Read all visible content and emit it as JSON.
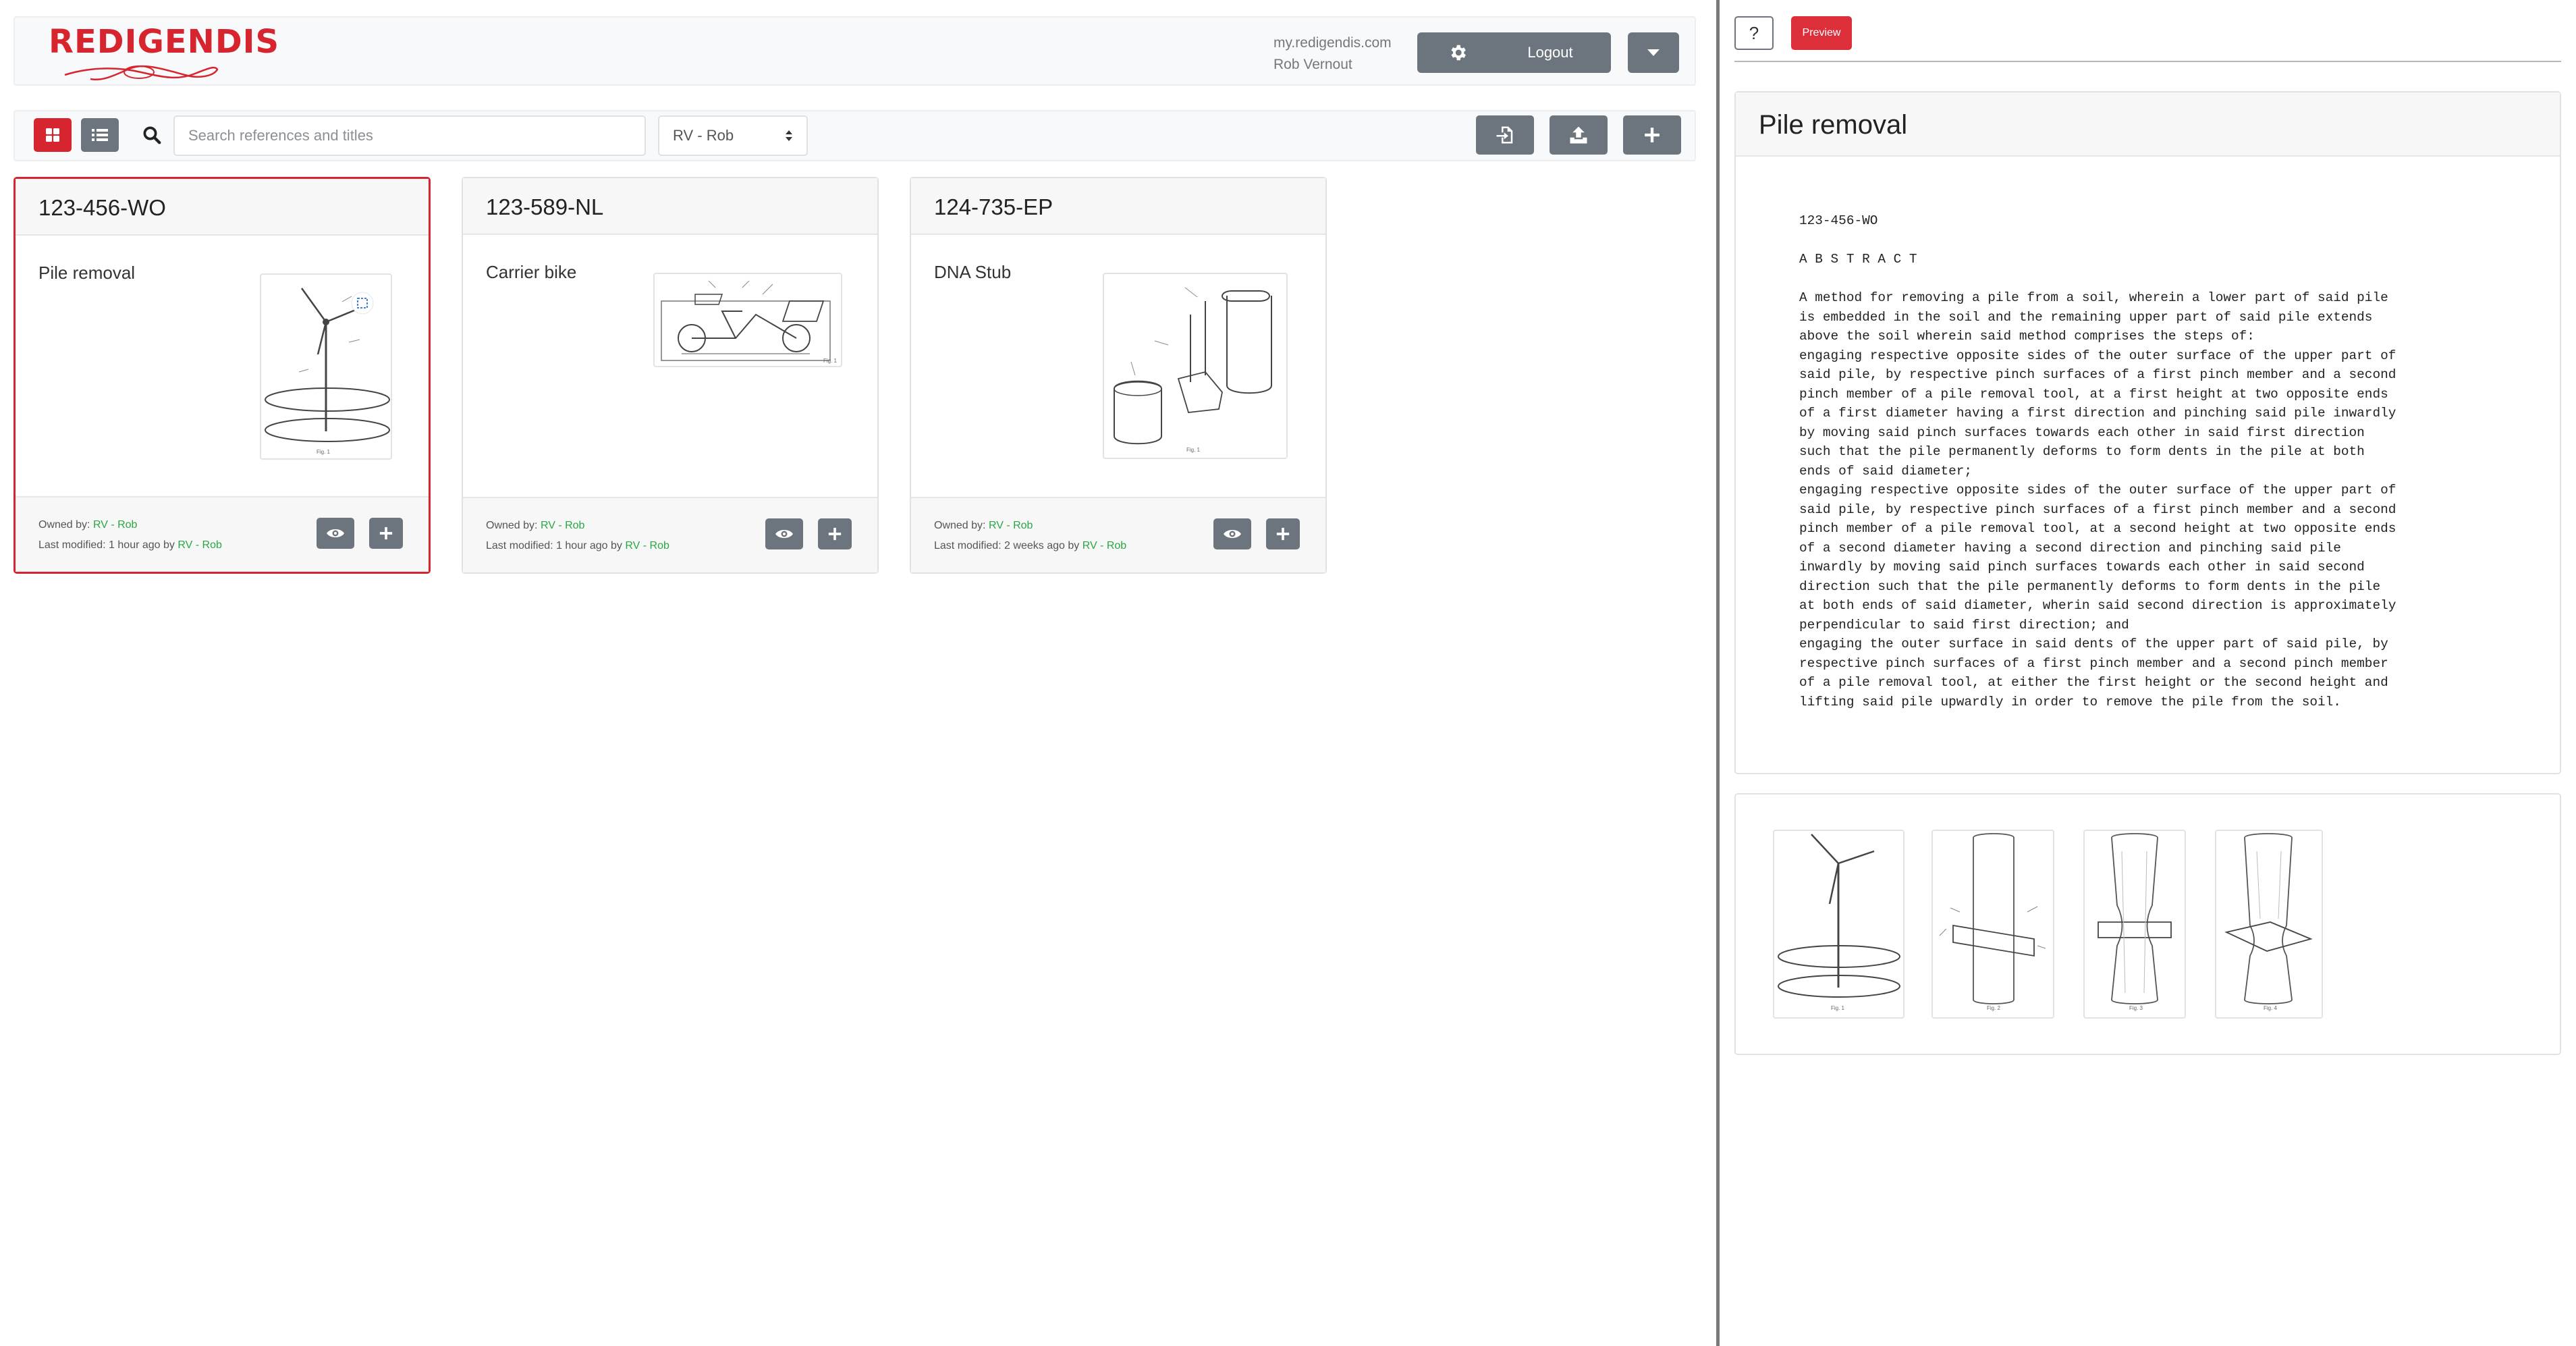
{
  "app": {
    "logo_text": "REDIGENDIS",
    "domain": "my.redigendis.com",
    "user": "Rob Vernout",
    "logout_label": "Logout",
    "brand_color": "#d7252f"
  },
  "toolbar": {
    "search_placeholder": "Search references and titles",
    "owner_filter": "RV - Rob"
  },
  "cards": [
    {
      "reference": "123-456-WO",
      "title": "Pile removal",
      "owned_label": "Owned by: ",
      "owner": "RV - Rob",
      "modified_label": "Last modified: 1 hour ago by ",
      "modified_by": "RV - Rob",
      "fig_caption": "Fig. 1",
      "selected": true
    },
    {
      "reference": "123-589-NL",
      "title": "Carrier bike",
      "owned_label": "Owned by: ",
      "owner": "RV - Rob",
      "modified_label": "Last modified: 1 hour ago by ",
      "modified_by": "RV - Rob",
      "fig_caption": "Fig. 1",
      "selected": false
    },
    {
      "reference": "124-735-EP",
      "title": "DNA Stub",
      "owned_label": "Owned by: ",
      "owner": "RV - Rob",
      "modified_label": "Last modified: 2 weeks ago by ",
      "modified_by": "RV - Rob",
      "fig_caption": "Fig. 1",
      "selected": false
    }
  ],
  "preview": {
    "help_label": "?",
    "preview_label": "Preview",
    "title": "Pile removal",
    "abstract_text": "123-456-WO\n\nA B S T R A C T\n\nA method for removing a pile from a soil, wherein a lower part of said pile\nis embedded in the soil and the remaining upper part of said pile extends\nabove the soil wherein said method comprises the steps of:\nengaging respective opposite sides of the outer surface of the upper part of\nsaid pile, by respective pinch surfaces of a first pinch member and a second\npinch member of a pile removal tool, at a first height at two opposite ends\nof a first diameter having a first direction and pinching said pile inwardly\nby moving said pinch surfaces towards each other in said first direction\nsuch that the pile permanently deforms to form dents in the pile at both\nends of said diameter;\nengaging respective opposite sides of the outer surface of the upper part of\nsaid pile, by respective pinch surfaces of a first pinch member and a second\npinch member of a pile removal tool, at a second height at two opposite ends\nof a second diameter having a second direction and pinching said pile\ninwardly by moving said pinch surfaces towards each other in said second\ndirection such that the pile permanently deforms to form dents in the pile\nat both ends of said diameter, wherin said second direction is approximately\nperpendicular to said first direction; and\nengaging the outer surface in said dents of the upper part of said pile, by\nrespective pinch surfaces of a first pinch member and a second pinch member\nof a pile removal tool, at either the first height or the second height and\nlifting said pile upwardly in order to remove the pile from the soil.",
    "figures": [
      "Fig. 1",
      "Fig. 2",
      "Fig. 3",
      "Fig. 4"
    ]
  }
}
